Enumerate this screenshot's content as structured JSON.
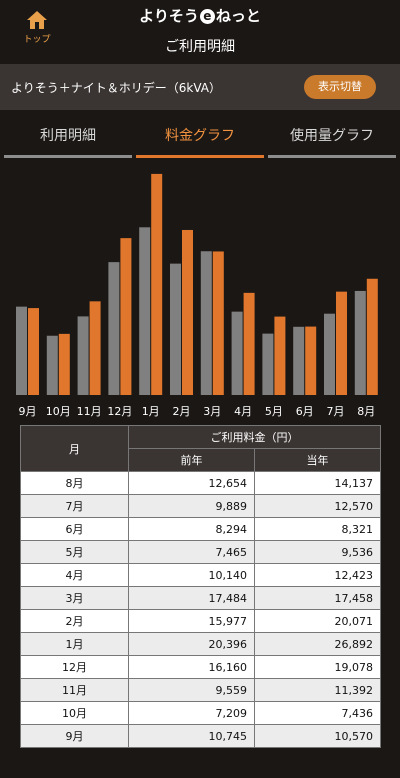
{
  "header": {
    "home_label": "トップ",
    "brand_pre": "よりそう",
    "brand_e": "e",
    "brand_post": "ねっと",
    "page_title": "ご利用明細"
  },
  "plan": {
    "name": "よりそう＋ナイト＆ホリデー（6kVA）",
    "switch_label": "表示切替"
  },
  "tabs": [
    {
      "label": "利用明細",
      "active": false
    },
    {
      "label": "料金グラフ",
      "active": true
    },
    {
      "label": "使用量グラフ",
      "active": false
    }
  ],
  "colors": {
    "previous_year": "#808080",
    "current_year": "#e0772c",
    "accent": "#ca7a2b"
  },
  "chart_data": {
    "type": "bar",
    "categories": [
      "9月",
      "10月",
      "11月",
      "12月",
      "1月",
      "2月",
      "3月",
      "4月",
      "5月",
      "6月",
      "7月",
      "8月"
    ],
    "series": [
      {
        "name": "前年",
        "values": [
          10745,
          7209,
          9559,
          16160,
          20396,
          15977,
          17484,
          10140,
          7465,
          8294,
          9889,
          12654
        ]
      },
      {
        "name": "当年",
        "values": [
          10570,
          7436,
          11392,
          19078,
          26892,
          20071,
          17458,
          12423,
          9536,
          8321,
          12570,
          14137
        ]
      }
    ],
    "ylim": [
      0,
      27000
    ],
    "grid": false,
    "legend": "none"
  },
  "table": {
    "month_header": "月",
    "group_header": "ご利用料金（円）",
    "prev_header": "前年",
    "curr_header": "当年",
    "rows": [
      {
        "month": "8月",
        "prev": "12,654",
        "curr": "14,137"
      },
      {
        "month": "7月",
        "prev": "9,889",
        "curr": "12,570"
      },
      {
        "month": "6月",
        "prev": "8,294",
        "curr": "8,321"
      },
      {
        "month": "5月",
        "prev": "7,465",
        "curr": "9,536"
      },
      {
        "month": "4月",
        "prev": "10,140",
        "curr": "12,423"
      },
      {
        "month": "3月",
        "prev": "17,484",
        "curr": "17,458"
      },
      {
        "month": "2月",
        "prev": "15,977",
        "curr": "20,071"
      },
      {
        "month": "1月",
        "prev": "20,396",
        "curr": "26,892"
      },
      {
        "month": "12月",
        "prev": "16,160",
        "curr": "19,078"
      },
      {
        "month": "11月",
        "prev": "9,559",
        "curr": "11,392"
      },
      {
        "month": "10月",
        "prev": "7,209",
        "curr": "7,436"
      },
      {
        "month": "9月",
        "prev": "10,745",
        "curr": "10,570"
      }
    ]
  }
}
